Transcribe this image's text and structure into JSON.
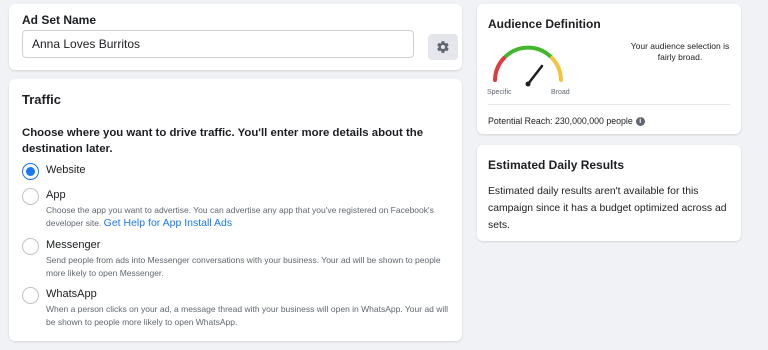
{
  "ad_set": {
    "label": "Ad Set Name",
    "value": "Anna Loves Burritos",
    "settings_icon": "gear-icon"
  },
  "traffic": {
    "title": "Traffic",
    "description": "Choose where you want to drive traffic. You'll enter more details about the destination later.",
    "options": [
      {
        "label": "Website",
        "selected": true,
        "help": "",
        "link": ""
      },
      {
        "label": "App",
        "selected": false,
        "help": "Choose the app you want to advertise. You can advertise any app that you've registered on Facebook's developer site.",
        "link": "Get Help for App Install Ads"
      },
      {
        "label": "Messenger",
        "selected": false,
        "help": "Send people from ads into Messenger conversations with your business. Your ad will be shown to people more likely to open Messenger.",
        "link": ""
      },
      {
        "label": "WhatsApp",
        "selected": false,
        "help": "When a person clicks on your ad, a message thread with your business will open in WhatsApp. Your ad will be shown to people more likely to open WhatsApp.",
        "link": ""
      }
    ]
  },
  "audience": {
    "title": "Audience Definition",
    "gauge_left": "Specific",
    "gauge_right": "Broad",
    "note": "Your audience selection is fairly broad.",
    "reach": "Potential Reach: 230,000,000 people",
    "colors": {
      "red": "#e0393e",
      "green": "#42b72a",
      "yellow": "#f5c33b",
      "needle": "#1c1e21"
    }
  },
  "daily": {
    "title": "Estimated Daily Results",
    "text": "Estimated daily results aren't available for this campaign since it has a budget optimized across ad sets."
  },
  "colors": {
    "accent": "#1877f2",
    "background": "#f0f2f5"
  }
}
